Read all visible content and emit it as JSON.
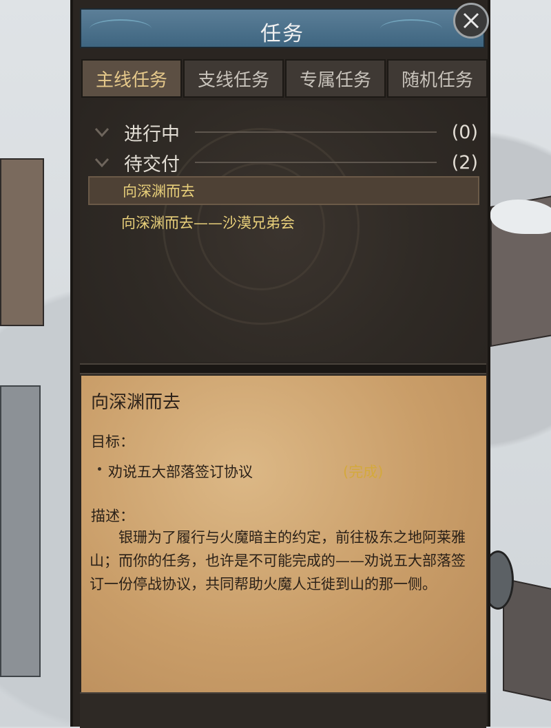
{
  "header": {
    "title": "任务"
  },
  "tabs": [
    {
      "label": "主线任务",
      "active": true
    },
    {
      "label": "支线任务",
      "active": false
    },
    {
      "label": "专属任务",
      "active": false
    },
    {
      "label": "随机任务",
      "active": false
    }
  ],
  "sections": [
    {
      "label": "进行中",
      "count": "(0)"
    },
    {
      "label": "待交付",
      "count": "(2)"
    }
  ],
  "quests": [
    {
      "name": "向深渊而去",
      "selected": true
    },
    {
      "name": "向深渊而去——沙漠兄弟会",
      "selected": false
    }
  ],
  "detail": {
    "title": "向深渊而去",
    "goal_label": "目标：",
    "objective": "劝说五大部落签订协议",
    "objective_status": "(完成)",
    "desc_label": "描述：",
    "description": "银珊为了履行与火魔暗主的约定，前往极东之地阿莱雅山；而你的任务，也许是不可能完成的——劝说五大部落签订一份停战协议，共同帮助火魔人迁徙到山的那一侧。"
  },
  "colors": {
    "tab_active_text": "#e6c98b",
    "quest_text": "#e8cf7a",
    "status_complete": "#d4a93c",
    "header_bg": "#4a6f8a",
    "parchment": "#c99d68"
  },
  "icons": {
    "close": "close-icon",
    "chevron": "chevron-down-icon"
  }
}
